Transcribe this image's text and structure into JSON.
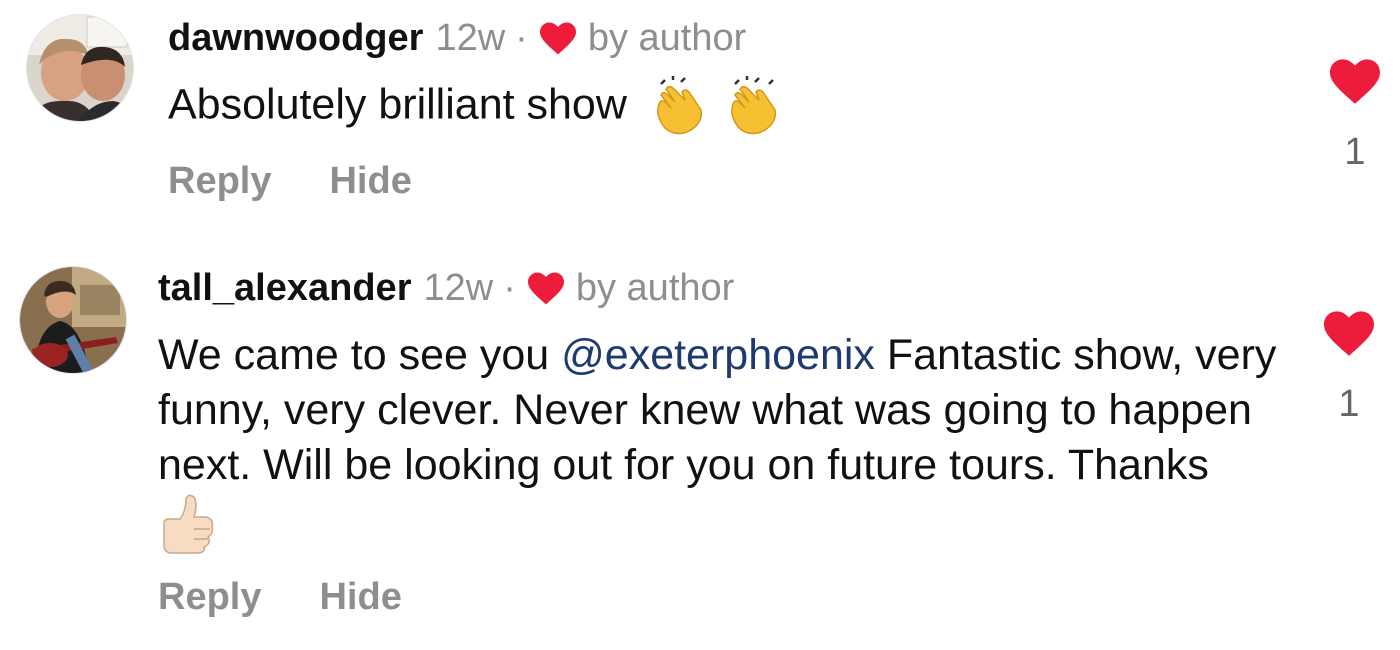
{
  "comments": [
    {
      "username": "dawnwoodger",
      "time": "12w",
      "separator": "·",
      "liked_label": "by author",
      "text": "Absolutely brilliant show",
      "emojis": [
        "clapping-hands",
        "clapping-hands"
      ],
      "reply_label": "Reply",
      "hide_label": "Hide",
      "like_count": "1"
    },
    {
      "username": "tall_alexander",
      "time": "12w",
      "separator": "·",
      "liked_label": "by author",
      "text_before": "We came to see you ",
      "mention": "@exeterphoenix",
      "text_after": " Fantastic show, very funny, very clever. Never knew what was going to happen next. Will be looking out for you on future tours. Thanks ",
      "emojis": [
        "thumbs-up"
      ],
      "reply_label": "Reply",
      "hide_label": "Hide",
      "like_count": "1"
    }
  ],
  "colors": {
    "heart": "#ed1c3b",
    "muted_text": "#8e8e8e",
    "mention": "#1f3a6e"
  }
}
